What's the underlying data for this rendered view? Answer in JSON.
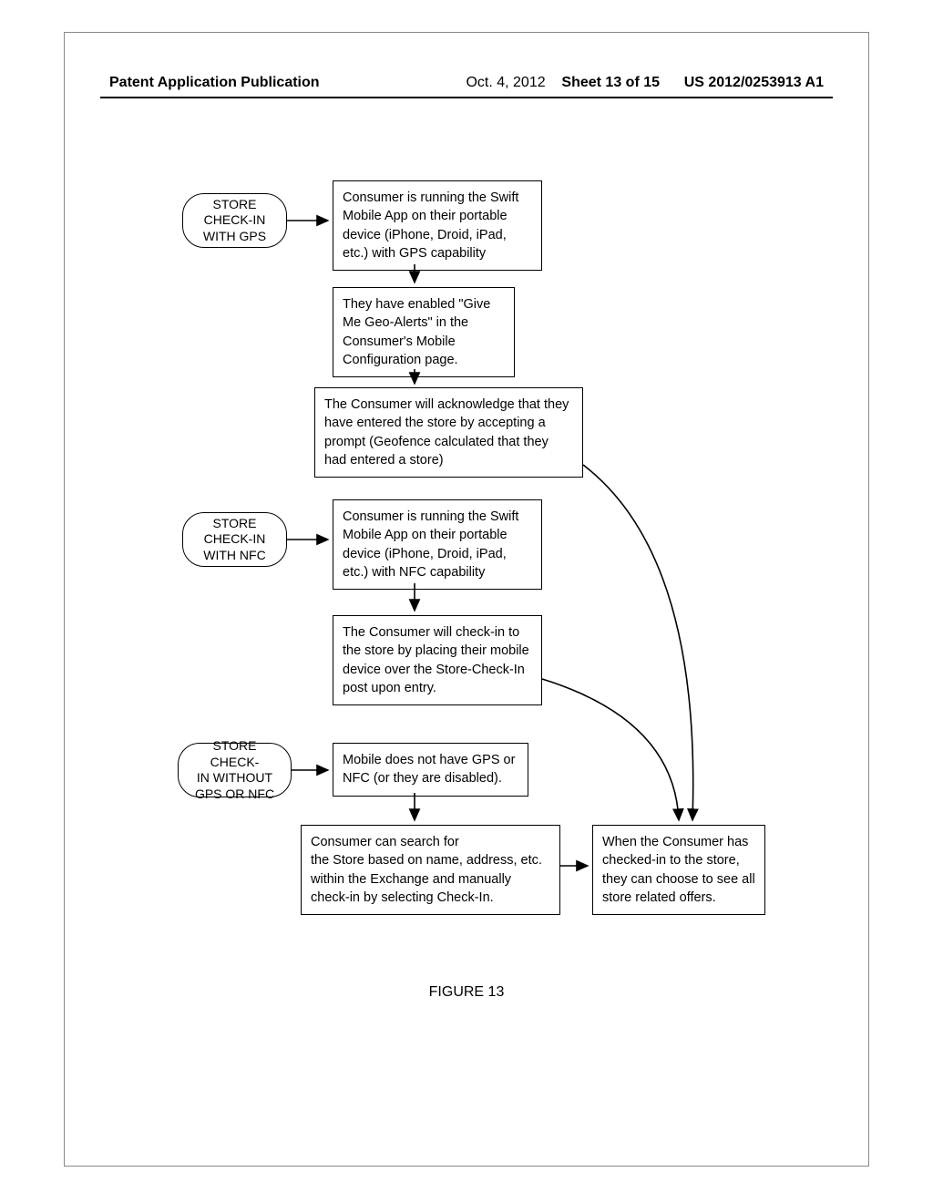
{
  "header": {
    "left": "Patent Application Publication",
    "date": "Oct. 4, 2012",
    "sheet": "Sheet 13 of 15",
    "pubno": "US 2012/0253913 A1"
  },
  "figure_label": "FIGURE 13",
  "nodes": {
    "term_gps": "STORE\nCHECK-IN\nWITH GPS",
    "term_nfc": "STORE\nCHECK-IN\nWITH NFC",
    "term_none": "STORE CHECK-\nIN WITHOUT\nGPS OR NFC",
    "gps1": "Consumer is running the Swift Mobile App on their portable device (iPhone, Droid, iPad, etc.) with GPS capability",
    "gps2": "They have enabled \"Give Me Geo-Alerts\" in the Consumer's Mobile Configuration page.",
    "gps3": "The Consumer will acknowledge that they have entered the store by accepting a prompt (Geofence calculated that they had entered a store)",
    "nfc1": "Consumer is running the Swift Mobile App on their portable device (iPhone, Droid, iPad, etc.) with NFC capability",
    "nfc2": "The Consumer will check-in to the store by placing their mobile device over the Store-Check-In post upon entry.",
    "none1": "Mobile does not have GPS or NFC (or they are disabled).",
    "none2": "Consumer can search for\nthe Store based on name, address, etc. within the Exchange and manually check-in by selecting Check-In.",
    "result": "When the Consumer has checked-in to the store, they can choose to see all store related offers."
  }
}
